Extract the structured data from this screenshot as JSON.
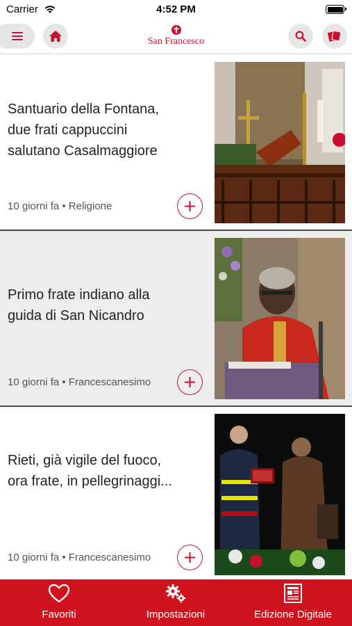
{
  "status_bar": {
    "carrier": "Carrier",
    "time": "4:52 PM"
  },
  "header": {
    "logo_text": "San Francesco",
    "icons": {
      "menu": "menu-icon",
      "home": "home-icon",
      "search": "search-icon",
      "magazine": "magazine-icon"
    }
  },
  "articles": [
    {
      "title_lines": [
        "Santuario della Fontana,",
        "due frati cappuccini",
        "salutano Casalmaggiore"
      ],
      "meta": "10 giorni fa • Religione"
    },
    {
      "title_lines": [
        "Primo frate indiano alla",
        "guida di San Nicandro"
      ],
      "meta": "10 giorni fa • Francescanesimo"
    },
    {
      "title_lines": [
        "Rieti, già vigile del fuoco,",
        "ora frate, in pellegrinaggi..."
      ],
      "meta": "10 giorni fa • Francescanesimo"
    }
  ],
  "tab_bar": {
    "items": [
      {
        "label": "Favoriti",
        "icon": "heart-icon"
      },
      {
        "label": "Impostazioni",
        "icon": "gears-icon"
      },
      {
        "label": "Edizione Digitale",
        "icon": "newspaper-icon"
      }
    ]
  },
  "colors": {
    "brand_red": "#d0141f",
    "accent_red": "#c8102e",
    "button_grey": "#e6e6e6",
    "alt_row_grey": "#ededed"
  }
}
